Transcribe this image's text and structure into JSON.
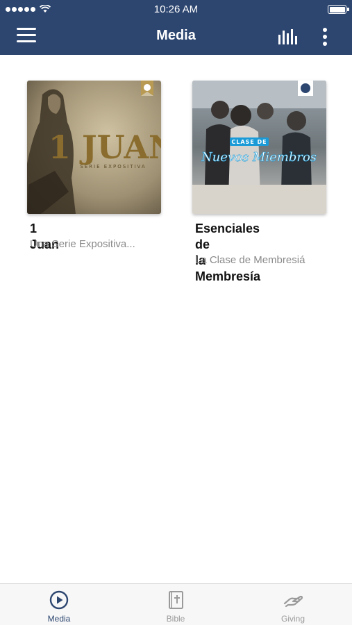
{
  "status": {
    "time": "10:26 AM"
  },
  "nav": {
    "title": "Media"
  },
  "cards": [
    {
      "title": "1 Juan",
      "subtitle": "Una Serie Expositiva...",
      "art_title": "1 JUAN",
      "art_sub": "SERIE EXPOSITIVA"
    },
    {
      "title_line1": "Esenciales de",
      "title_line2": "la Membresía",
      "subtitle": "La Clase de Membresiá",
      "art_top": "CLASE DE",
      "art_main": "Nuevos Miembros"
    }
  ],
  "tabs": [
    {
      "label": "Media",
      "icon": "play-circle-icon",
      "active": true
    },
    {
      "label": "Bible",
      "icon": "bible-icon",
      "active": false
    },
    {
      "label": "Giving",
      "icon": "giving-hand-icon",
      "active": false
    }
  ],
  "colors": {
    "header": "#2d4670",
    "active_tab": "#2d4670",
    "inactive_tab": "#9a9a9a"
  }
}
